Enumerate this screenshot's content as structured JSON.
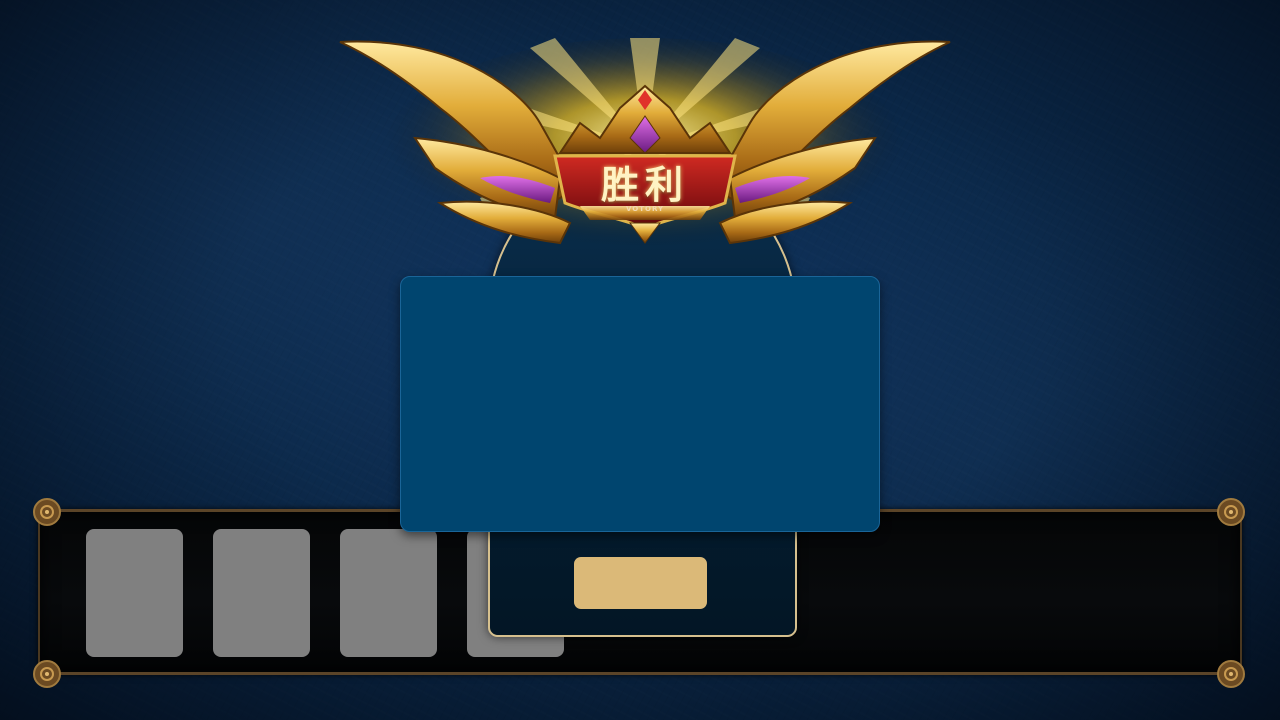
{
  "banner": {
    "title": "胜利",
    "subtitle": "VOTORY"
  },
  "tray": {
    "card_slot_count": 4
  },
  "confirm_button": {
    "label": ""
  },
  "colors": {
    "background": "#0b2a4c",
    "main_panel": "#00456f",
    "card_slot": "#808080",
    "confirm_button": "#dbb978",
    "panel_border": "#d6c08e",
    "banner_red": "#8e1414",
    "gold": "#d9a935"
  },
  "icons": {
    "tray_corner": "ornate-swirl-icon",
    "crest": "victory-crest-icon"
  }
}
